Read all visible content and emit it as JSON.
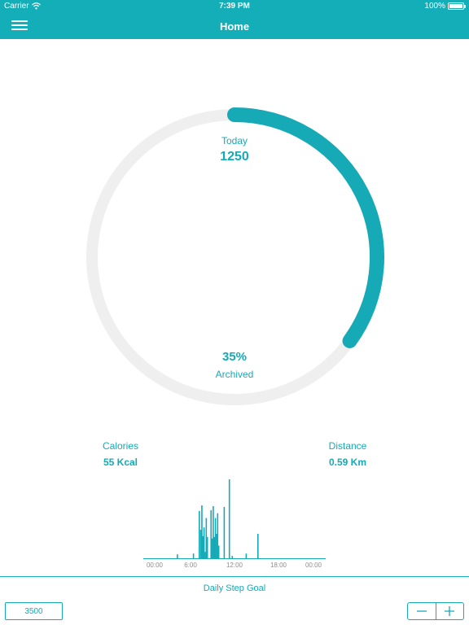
{
  "status_bar": {
    "carrier": "Carrier",
    "time": "7:39 PM",
    "battery": "100%"
  },
  "nav": {
    "title": "Home"
  },
  "ring": {
    "today_label": "Today",
    "today_value": "1250",
    "percent_label": "35%",
    "archived_label": "Archived",
    "progress": 0.35
  },
  "stats": {
    "calories_label": "Calories",
    "calories_value": "55 Kcal",
    "distance_label": "Distance",
    "distance_value": "0.59 Km"
  },
  "chart_data": {
    "type": "bar",
    "title": "",
    "xlabel": "",
    "ylabel": "",
    "x_ticks": [
      "00:00",
      "6:00",
      "12:00",
      "18:00",
      "00:00"
    ],
    "x_unit": "hour of day",
    "xlim": [
      0,
      24
    ],
    "ylim": [
      0,
      1
    ],
    "x": [
      3.8,
      6.4,
      7.2,
      7.4,
      7.55,
      7.7,
      7.85,
      8.0,
      8.15,
      8.3,
      8.8,
      8.95,
      9.1,
      9.25,
      9.4,
      9.55,
      9.7,
      9.85,
      10.6,
      11.3,
      11.7,
      13.6,
      15.2
    ],
    "values": [
      0.05,
      0.06,
      0.6,
      0.36,
      0.67,
      0.28,
      0.39,
      0.08,
      0.51,
      0.27,
      0.61,
      0.25,
      0.66,
      0.27,
      0.51,
      0.31,
      0.57,
      0.16,
      0.65,
      1.0,
      0.03,
      0.06,
      0.31
    ],
    "grid": false,
    "color": "#16a9b6"
  },
  "goal": {
    "label": "Daily Step Goal",
    "value": "3500"
  },
  "colors": {
    "accent": "#14aeb8",
    "track": "#efefef",
    "tick_text": "#8e8e8e"
  },
  "icons": {
    "menu": "hamburger-icon",
    "wifi": "wifi-icon",
    "minus": "minus-icon",
    "plus": "plus-icon"
  }
}
